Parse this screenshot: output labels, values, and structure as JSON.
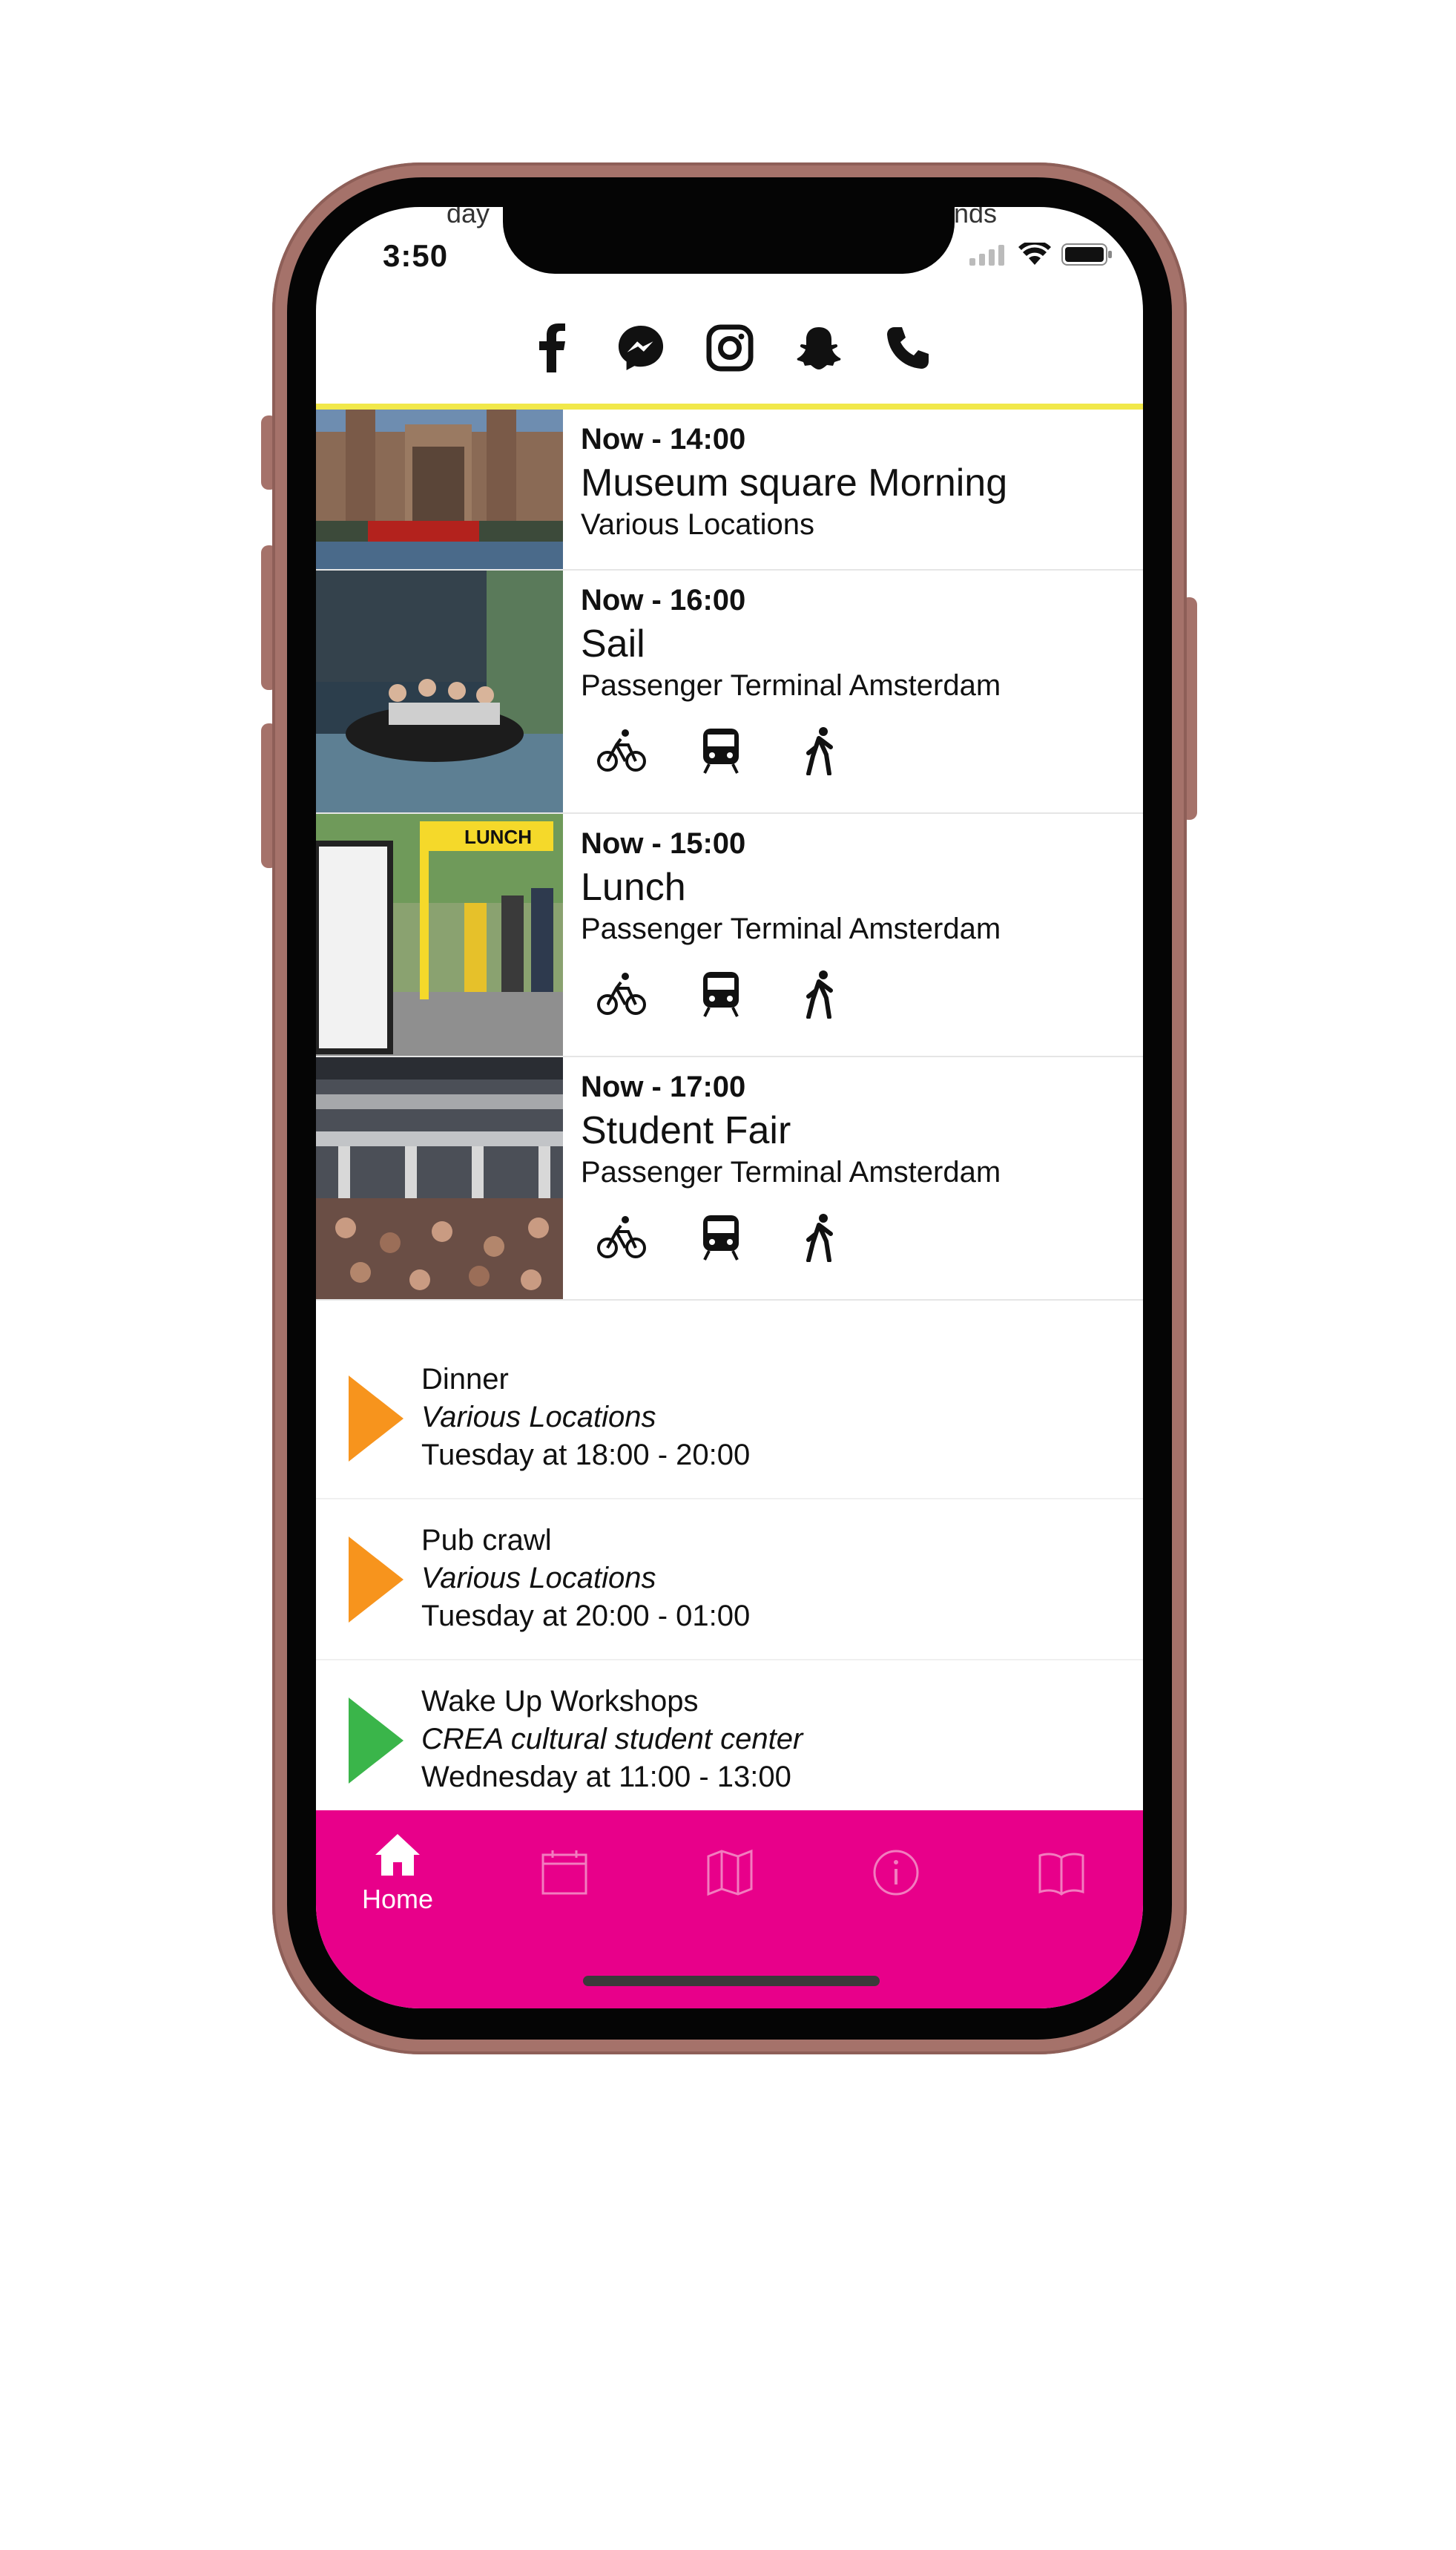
{
  "status_bar": {
    "time": "3:50",
    "peek_left": "day",
    "peek_right": "nds"
  },
  "social": [
    "facebook-icon",
    "messenger-icon",
    "instagram-icon",
    "snapchat-icon",
    "phone-icon"
  ],
  "colors": {
    "accent_bar": "#f1e84a",
    "tabbar": "#e8008a",
    "orange": "#f7941d",
    "green": "#3ab54a"
  },
  "events": [
    {
      "time": "Now - 14:00",
      "title": "Museum square Morning",
      "location": "Various Locations",
      "transport": false
    },
    {
      "time": "Now - 16:00",
      "title": "Sail",
      "location": "Passenger Terminal Amsterdam",
      "transport": true
    },
    {
      "time": "Now - 15:00",
      "title": "Lunch",
      "location": "Passenger Terminal Amsterdam",
      "transport": true
    },
    {
      "time": "Now - 17:00",
      "title": "Student Fair",
      "location": "Passenger Terminal Amsterdam",
      "transport": true
    }
  ],
  "upcoming": [
    {
      "title": "Dinner",
      "location": "Various Locations",
      "when": "Tuesday at 18:00 - 20:00",
      "color": "#f7941d"
    },
    {
      "title": "Pub crawl",
      "location": "Various Locations",
      "when": "Tuesday at 20:00 - 01:00",
      "color": "#f7941d"
    },
    {
      "title": "Wake Up Workshops",
      "location": "CREA cultural student center",
      "when": "Wednesday at 11:00 - 13:00",
      "color": "#3ab54a"
    }
  ],
  "tabs": {
    "home_label": "Home"
  }
}
